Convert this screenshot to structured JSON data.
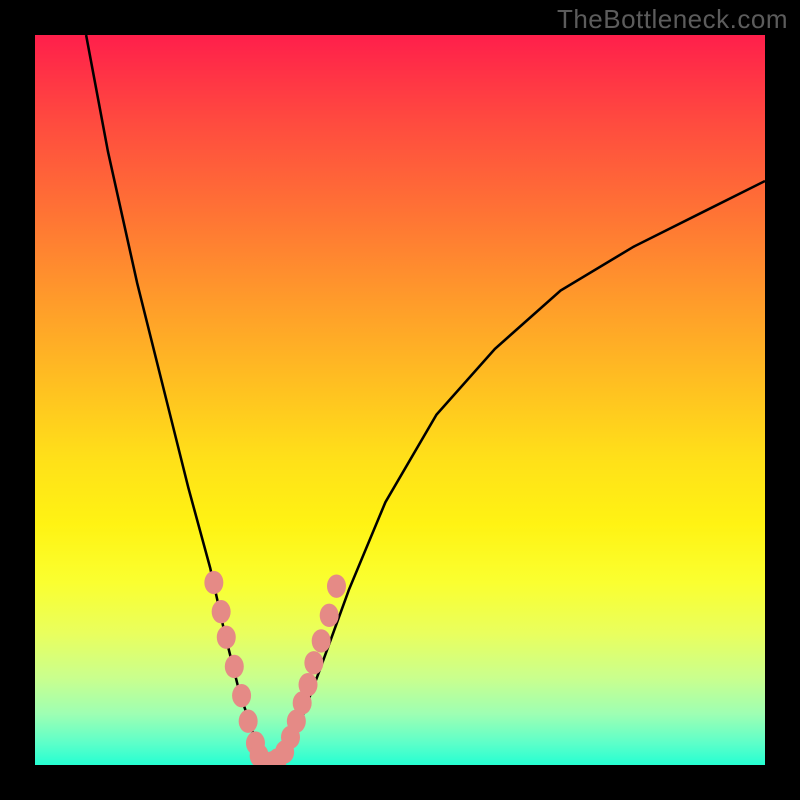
{
  "watermark": "TheBottleneck.com",
  "chart_data": {
    "type": "line",
    "title": "",
    "xlabel": "",
    "ylabel": "",
    "xlim": [
      0,
      100
    ],
    "ylim": [
      0,
      100
    ],
    "background_gradient": {
      "top": "#ff1f4b",
      "bottom": "#25ffd2"
    },
    "series": [
      {
        "name": "left-branch",
        "color": "#000000",
        "x": [
          7,
          10,
          14,
          18,
          21,
          24,
          26,
          28,
          30,
          31.5
        ],
        "y": [
          100,
          84,
          66,
          50,
          38,
          27,
          18,
          10,
          4,
          0
        ]
      },
      {
        "name": "right-branch",
        "color": "#000000",
        "x": [
          34,
          36,
          39,
          43,
          48,
          55,
          63,
          72,
          82,
          92,
          100
        ],
        "y": [
          0,
          5,
          13,
          24,
          36,
          48,
          57,
          65,
          71,
          76,
          80
        ]
      },
      {
        "name": "scatter-markers",
        "color": "#e58a86",
        "type": "scatter",
        "x": [
          24.5,
          25.5,
          26.2,
          27.3,
          28.3,
          29.2,
          30.2,
          30.7,
          31.5,
          32.5,
          33.2,
          34.2,
          35,
          35.8,
          36.6,
          37.4,
          38.2,
          39.2,
          40.3,
          41.3
        ],
        "y": [
          25,
          21,
          17.5,
          13.5,
          9.5,
          6,
          3,
          1.3,
          0.3,
          0.3,
          0.7,
          1.8,
          3.8,
          6,
          8.5,
          11,
          14,
          17,
          20.5,
          24.5
        ]
      }
    ]
  }
}
